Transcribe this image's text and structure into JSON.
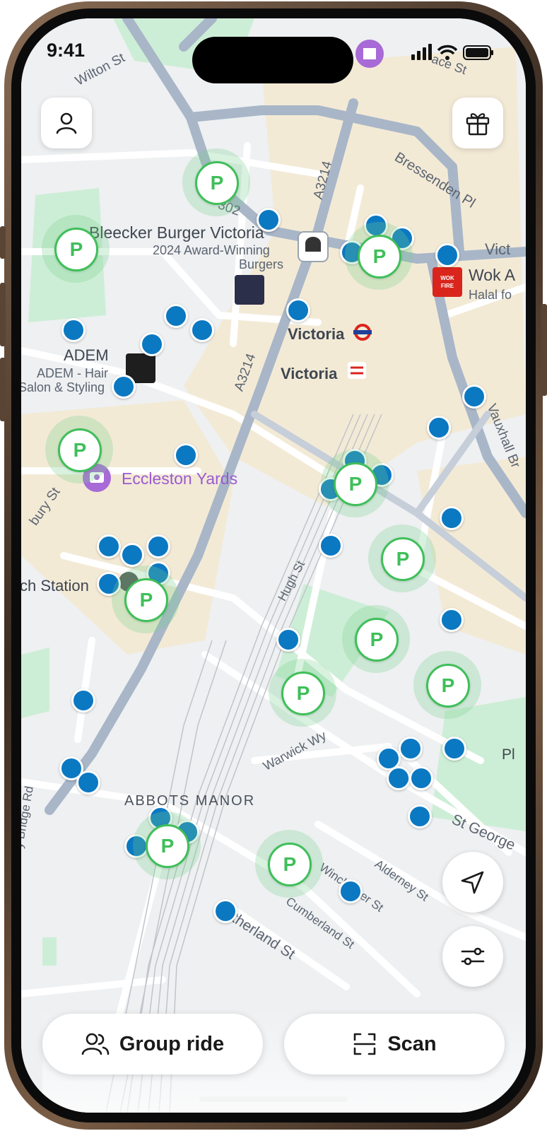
{
  "status_bar": {
    "time": "9:41"
  },
  "map": {
    "place_labels": {
      "wilton_st": "Wilton St",
      "bressenden_pl": "Bressenden Pl",
      "a3214_north": "A3214",
      "a3214_south": "A3214",
      "bleecker_burger": "Bleecker Burger Victoria",
      "bleecker_sub1": "2024 Award-Winning",
      "bleecker_sub2": "Burgers",
      "wok_fire": "Wok A",
      "wok_fire_sub": "Halal fo",
      "victoria_tube": "Victoria",
      "victoria_rail": "Victoria",
      "adem": "ADEM",
      "adem_sub1": "ADEM - Hair",
      "adem_sub2": "Salon & Styling",
      "eccleston_yards": "Eccleston Yards",
      "coach_station": "ch Station",
      "bury_st": "bury St",
      "hugh_st": "Hugh St",
      "warwick_wy": "Warwick Wy",
      "abbots_manor": "ABBOTS MANOR",
      "st_george": "St George",
      "alderney_st": "Alderney St",
      "winchester_st": "Winchester St",
      "cumberland_st": "Cumberland St",
      "sutherland_st": "Sutherland St",
      "vauxhall_br": "Vauxhall Br",
      "bridge_rd": "y Bridge Rd",
      "pl_fragment": "Pl",
      "top_fragment": "Vict",
      "road_302": "302"
    },
    "parking_marker_label": "P",
    "colors": {
      "parking": "#3fbf5a",
      "scooter": "#0b78c2",
      "park": "#cdeed6",
      "road": "#a8b6c8",
      "beige": "#f3ead6"
    }
  },
  "controls": {
    "profile_icon": "user-icon",
    "gift_icon": "gift-icon",
    "locate_icon": "navigation-arrow-icon",
    "filter_icon": "sliders-icon"
  },
  "bottom_bar": {
    "group_ride_label": "Group ride",
    "scan_label": "Scan"
  }
}
